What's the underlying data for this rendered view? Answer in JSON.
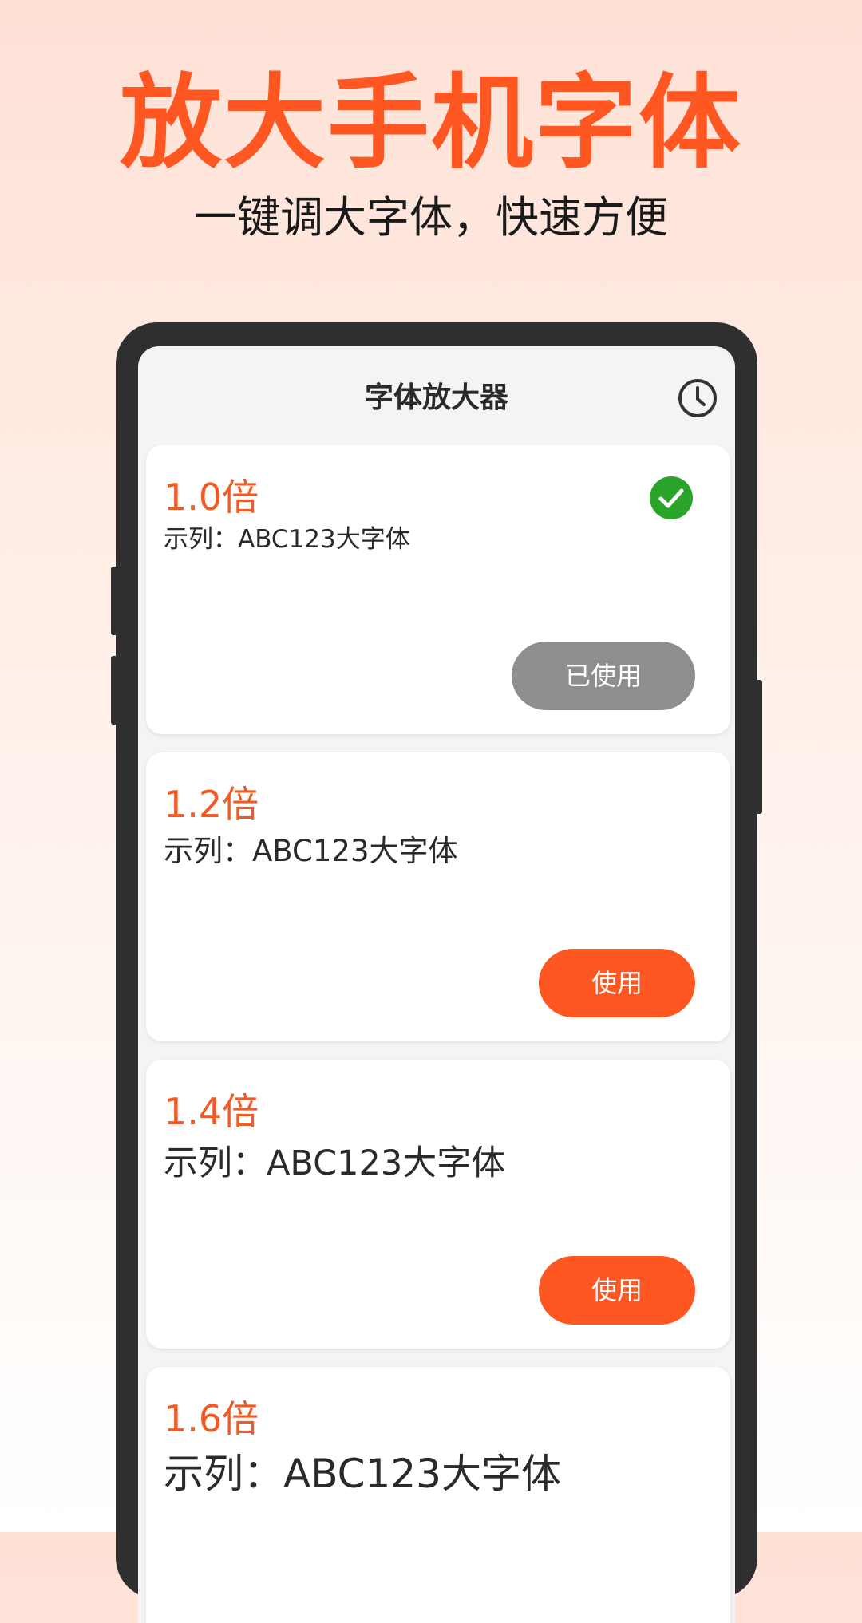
{
  "headline": "放大手机字体",
  "subheadline": "一键调大字体，快速方便",
  "app": {
    "title": "字体放大器",
    "history_icon": "clock-history-icon"
  },
  "colors": {
    "accent": "#FF5722",
    "scale_text": "#F15A24",
    "used_button": "#8F8E8E",
    "check_green": "#2AA52A"
  },
  "cards": [
    {
      "scale": "1.0倍",
      "sample": "示列：ABC123大字体",
      "button": "已使用",
      "selected": true
    },
    {
      "scale": "1.2倍",
      "sample": "示列：ABC123大字体",
      "button": "使用",
      "selected": false
    },
    {
      "scale": "1.4倍",
      "sample": "示列：ABC123大字体",
      "button": "使用",
      "selected": false
    },
    {
      "scale": "1.6倍",
      "sample": "示列：ABC123大字体",
      "selected": false
    }
  ]
}
